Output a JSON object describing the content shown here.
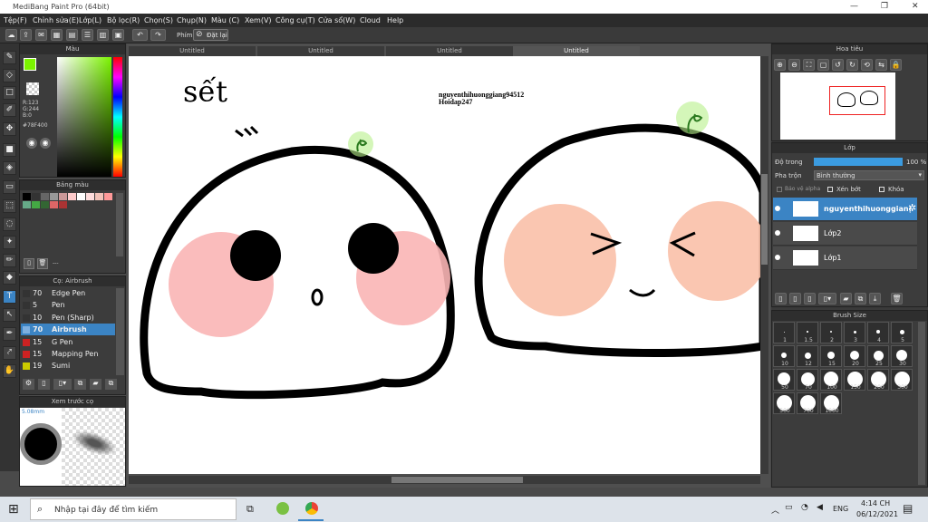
{
  "app": {
    "title": "MediBang Paint Pro (64bit)"
  },
  "menu": [
    "Tệp(F)",
    "Chỉnh sửa(E)",
    "Lớp(L)",
    "Bộ lọc(R)",
    "Chọn(S)",
    "Chụp(N)",
    "Màu (C)",
    "Xem(V)",
    "Công cụ(T)",
    "Cửa sổ(W)",
    "Cloud",
    "Help"
  ],
  "toolbar": {
    "undo": "↶",
    "redo": "↷",
    "hotkey_label": "Phím",
    "reset_label": "Đặt lại"
  },
  "color_panel": {
    "title": "Màu",
    "r": "R:123",
    "g": "G:244",
    "b": "B:0",
    "hex": "#78F400",
    "fg_color": "#7bf400",
    "bg_color": "#000000"
  },
  "palette_panel": {
    "title": "Bảng màu",
    "swatches": [
      "#000000",
      "#333333",
      "#666666",
      "#999999",
      "#cc9999",
      "#ffcccc",
      "#ffffff",
      "#ffdddd",
      "#f3c2b9",
      "#ff9999",
      "#66aa88",
      "#44aa44",
      "#336633",
      "#dd6666",
      "#aa3333"
    ],
    "footer": "---"
  },
  "brush_panel": {
    "title": "Cọ: Airbrush",
    "items": [
      {
        "size": "70",
        "name": "Edge Pen",
        "color": "#333333"
      },
      {
        "size": "5",
        "name": "Pen",
        "color": "#333333"
      },
      {
        "size": "10",
        "name": "Pen (Sharp)",
        "color": "#333333"
      },
      {
        "size": "70",
        "name": "Airbrush",
        "color": "#7fb0e0"
      },
      {
        "size": "15",
        "name": "G Pen",
        "color": "#cc2222"
      },
      {
        "size": "15",
        "name": "Mapping Pen",
        "color": "#cc2222"
      },
      {
        "size": "19",
        "name": "Sumi",
        "color": "#cccc00"
      }
    ]
  },
  "preview_panel": {
    "title": "Xem trước cọ",
    "size_label": "5.08mm"
  },
  "tabs": [
    "Untitled",
    "Untitled",
    "Untitled",
    "Untitled"
  ],
  "canvas_text": {
    "handwriting": "sết",
    "credit_line1": "nguyenthihuonggiang94512",
    "credit_line2": "Hoidap247"
  },
  "navigator": {
    "title": "Hoa tiêu"
  },
  "layer_panel": {
    "title": "Lớp",
    "opacity_label": "Độ trong",
    "opacity_value": "100 %",
    "blend_label": "Pha trộn",
    "blend_value": "Bình thường",
    "protect_alpha": "Bảo vệ alpha",
    "clipping": "Xén bớt",
    "lock": "Khóa",
    "layers": [
      {
        "name": "nguyenthihuonggiang",
        "selected": true
      },
      {
        "name": "Lớp2",
        "selected": false
      },
      {
        "name": "Lớp1",
        "selected": false
      }
    ]
  },
  "brush_size_panel": {
    "title": "Brush Size",
    "sizes": [
      "1",
      "1.5",
      "2",
      "3",
      "4",
      "5",
      "10",
      "12",
      "15",
      "20",
      "25",
      "30",
      "50",
      "70",
      "100",
      "150",
      "200",
      "300",
      "500",
      "700",
      "1000"
    ]
  },
  "taskbar": {
    "search_placeholder": "Nhập tại đây để tìm kiếm",
    "lang": "ENG",
    "time": "4:14 CH",
    "date": "06/12/2021"
  }
}
